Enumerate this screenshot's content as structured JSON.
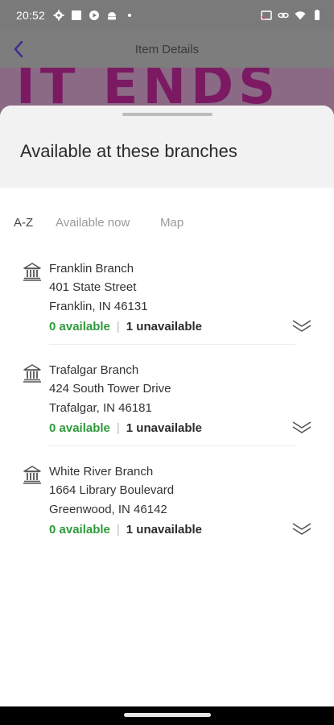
{
  "status_bar": {
    "time": "20:52",
    "left_icons": [
      "gear-icon",
      "square-icon",
      "media-icon",
      "android-icon",
      "dot-icon"
    ],
    "right_icons": [
      "cast-icon",
      "link-icon",
      "wifi-icon",
      "battery-icon"
    ]
  },
  "app_bar": {
    "title": "Item Details",
    "back_icon": "chevron-left-icon",
    "accent_color": "#3a2f8f"
  },
  "hero": {
    "text": "IT ENDS"
  },
  "sheet": {
    "title": "Available at these branches",
    "tabs": [
      {
        "label": "A-Z",
        "active": true
      },
      {
        "label": "Available now",
        "active": false
      },
      {
        "label": "Map",
        "active": false
      }
    ],
    "branches": [
      {
        "name": "Franklin Branch",
        "street": "401 State Street",
        "city": "Franklin, IN 46131",
        "available": "0 available",
        "unavailable": "1 unavailable"
      },
      {
        "name": "Trafalgar Branch",
        "street": "424 South Tower Drive",
        "city": "Trafalgar, IN 46181",
        "available": "0 available",
        "unavailable": "1 unavailable"
      },
      {
        "name": "White River Branch",
        "street": "1664 Library Boulevard",
        "city": "Greenwood, IN 46142",
        "available": "0 available",
        "unavailable": "1 unavailable"
      }
    ],
    "separator": "|",
    "colors": {
      "available": "#2e9a3a",
      "unavailable": "#2b2b2b"
    }
  }
}
